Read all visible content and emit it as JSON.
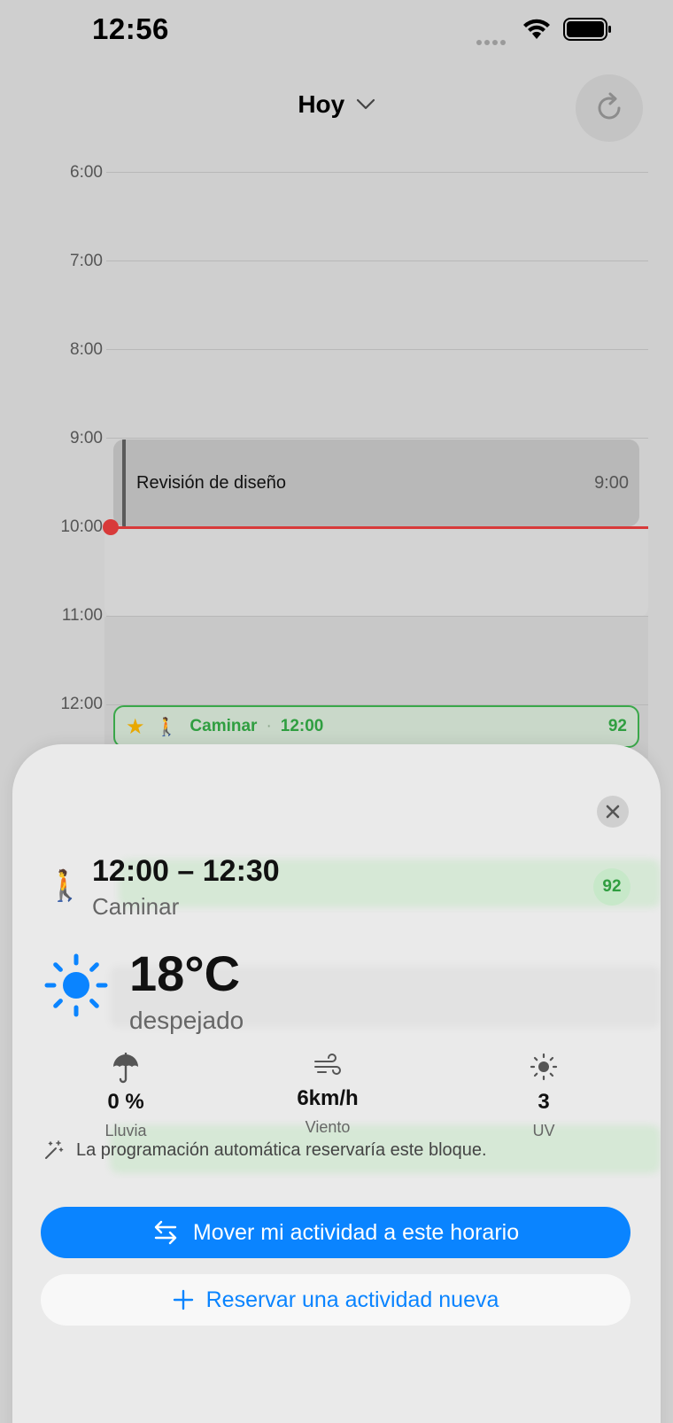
{
  "status_bar": {
    "time": "12:56"
  },
  "header": {
    "title": "Hoy"
  },
  "timeline": {
    "hours": [
      "6:00",
      "7:00",
      "8:00",
      "9:00",
      "10:00",
      "11:00",
      "12:00"
    ],
    "event": {
      "title": "Revisión de diseño",
      "time": "9:00"
    },
    "activity": {
      "emoji": "🚶",
      "name": "Caminar",
      "time": "12:00",
      "score": "92"
    }
  },
  "sheet": {
    "slot_time": "12:00 – 12:30",
    "activity_name": "Caminar",
    "activity_emoji": "🚶",
    "score": "92",
    "weather": {
      "temperature": "18°C",
      "condition": "despejado",
      "rain": {
        "value": "0 %",
        "label": "Lluvia"
      },
      "wind": {
        "value": "6km/h",
        "label": "Viento"
      },
      "uv": {
        "value": "3",
        "label": "UV"
      }
    },
    "hint": "La programación automática reservaría este bloque.",
    "primary_button": "Mover mi actividad a este horario",
    "secondary_button": "Reservar una actividad nueva"
  },
  "colors": {
    "accent": "#0a84ff",
    "score_green": "#2f9e40",
    "now_red": "#d83a3a"
  }
}
